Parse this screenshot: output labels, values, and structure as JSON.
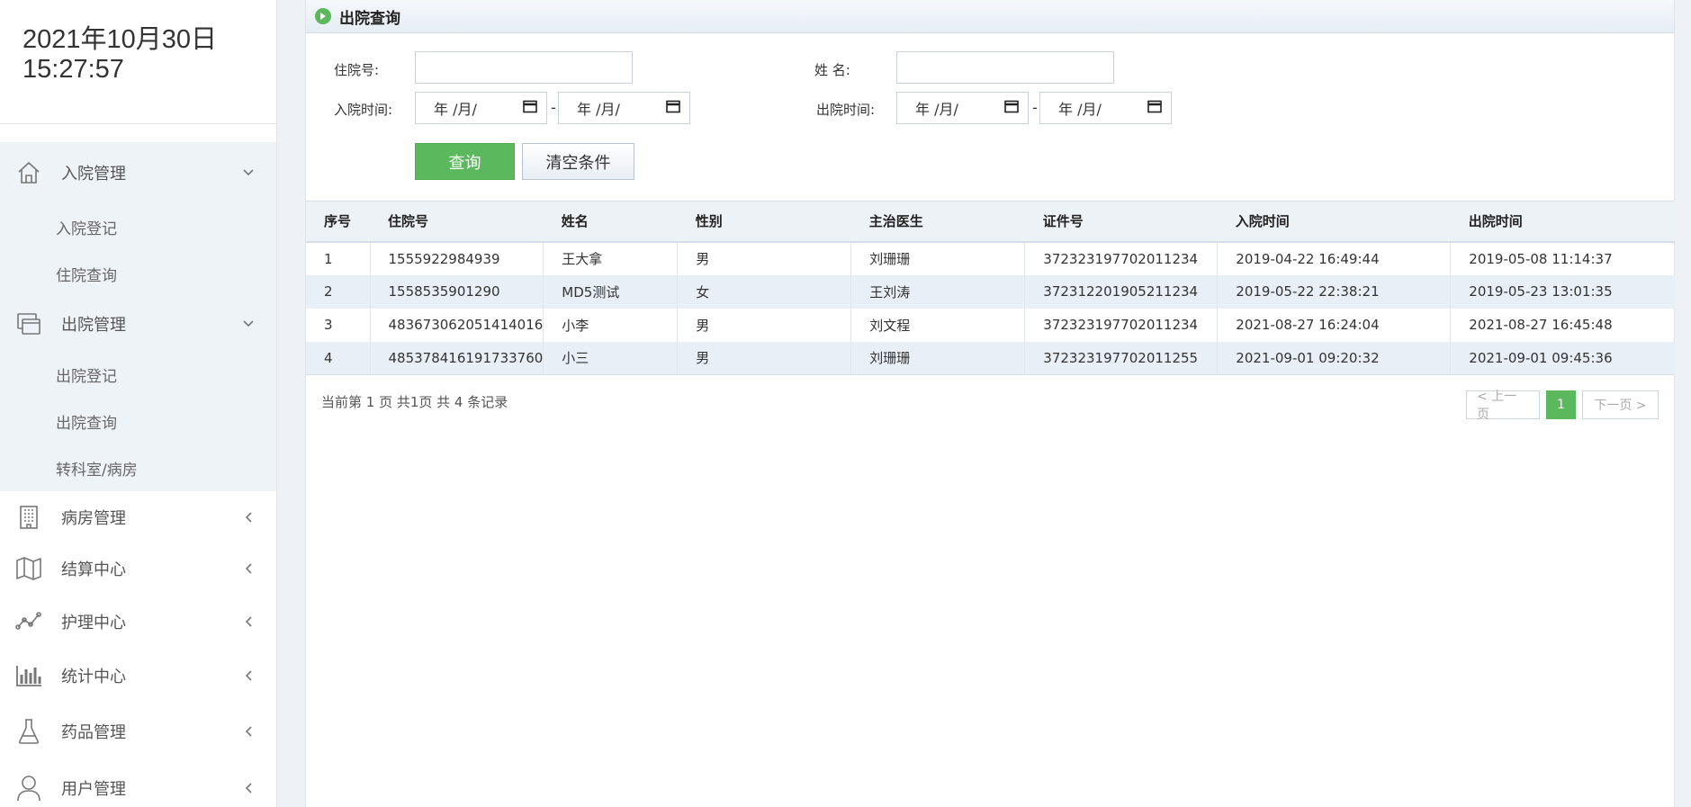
{
  "clock": {
    "date": "2021年10月30日",
    "time": "15:27:57"
  },
  "sidebar": {
    "groups": [
      {
        "label": "入院管理",
        "icon": "home-icon",
        "expanded": true,
        "items": [
          "入院登记",
          "住院查询"
        ]
      },
      {
        "label": "出院管理",
        "icon": "windows-icon",
        "expanded": true,
        "items": [
          "出院登记",
          "出院查询",
          "转科室/病房"
        ]
      },
      {
        "label": "病房管理",
        "icon": "building-icon",
        "expanded": false
      },
      {
        "label": "结算中心",
        "icon": "map-icon",
        "expanded": false
      },
      {
        "label": "护理中心",
        "icon": "line-chart-icon",
        "expanded": false
      },
      {
        "label": "统计中心",
        "icon": "bar-chart-icon",
        "expanded": false
      },
      {
        "label": "药品管理",
        "icon": "flask-icon",
        "expanded": false
      },
      {
        "label": "用户管理",
        "icon": "user-icon",
        "expanded": false
      }
    ]
  },
  "panel": {
    "title": "出院查询"
  },
  "form": {
    "inpatient_no_label": "住院号:",
    "name_label": "姓 名:",
    "admit_time_label": "入院时间:",
    "discharge_time_label": "出院时间:",
    "date_placeholder": "年 /月/",
    "range_dash": "-",
    "query_button": "查询",
    "clear_button": "清空条件"
  },
  "table": {
    "headers": [
      "序号",
      "住院号",
      "姓名",
      "性别",
      "主治医生",
      "证件号",
      "入院时间",
      "出院时间"
    ],
    "rows": [
      [
        "1",
        "1555922984939",
        "王大拿",
        "男",
        "刘珊珊",
        "372323197702011234",
        "2019-04-22 16:49:44",
        "2019-05-08 11:14:37"
      ],
      [
        "2",
        "1558535901290",
        "MD5测试",
        "女",
        "王刘涛",
        "372312201905211234",
        "2019-05-22 22:38:21",
        "2019-05-23 13:01:35"
      ],
      [
        "3",
        "483673062051414016",
        "小李",
        "男",
        "刘文程",
        "372323197702011234",
        "2021-08-27 16:24:04",
        "2021-08-27 16:45:48"
      ],
      [
        "4",
        "485378416191733760",
        "小三",
        "男",
        "刘珊珊",
        "372323197702011255",
        "2021-09-01 09:20:32",
        "2021-09-01 09:45:36"
      ]
    ]
  },
  "pager": {
    "info": "当前第 1 页  共1页  共 4 条记录",
    "prev": "< 上一页",
    "current": "1",
    "next": "下一页 >"
  },
  "colors": {
    "accent": "#5cb85c",
    "row_alt": "#e8eff6",
    "header_bg": "#edf2f7"
  }
}
